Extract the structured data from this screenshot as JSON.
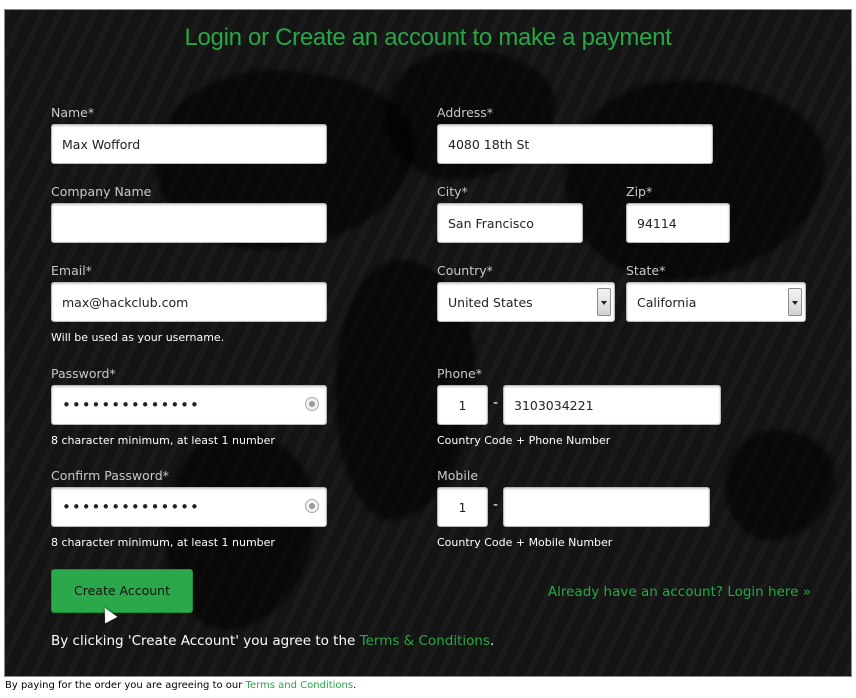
{
  "page": {
    "title": "Login or Create an account to make a payment",
    "accent_color": "#27a844",
    "background_color": "#141414"
  },
  "form": {
    "name": {
      "label": "Name*",
      "value": "Max Wofford"
    },
    "company": {
      "label": "Company Name",
      "value": ""
    },
    "email": {
      "label": "Email*",
      "value": "max@hackclub.com",
      "hint": "Will be used as your username."
    },
    "password": {
      "label": "Password*",
      "value": "••••••••••••••",
      "hint": "8 character minimum, at least 1 number",
      "icon": "reveal-password-icon"
    },
    "confirm_password": {
      "label": "Confirm Password*",
      "value": "••••••••••••••",
      "hint": "8 character minimum, at least 1 number",
      "icon": "reveal-password-icon"
    },
    "address": {
      "label": "Address*",
      "value": "4080 18th St"
    },
    "city": {
      "label": "City*",
      "value": "San Francisco"
    },
    "zip": {
      "label": "Zip*",
      "value": "94114"
    },
    "country": {
      "label": "Country*",
      "selected": "United States"
    },
    "state": {
      "label": "State*",
      "selected": "California"
    },
    "phone": {
      "label": "Phone*",
      "country_code": "1",
      "separator": "-",
      "number": "3103034221",
      "hint": "Country Code + Phone Number"
    },
    "mobile": {
      "label": "Mobile",
      "country_code": "1",
      "separator": "-",
      "number": "",
      "hint": "Country Code + Mobile Number"
    }
  },
  "actions": {
    "create_account": "Create Account",
    "login_link": "Already have an account? Login here »",
    "agree_prefix": "By clicking 'Create Account' you agree to the ",
    "agree_link": "Terms & Conditions",
    "agree_suffix": "."
  },
  "footer": {
    "prefix": "By paying for the order you are agreeing to our ",
    "link": "Terms and Conditions",
    "suffix": "."
  }
}
